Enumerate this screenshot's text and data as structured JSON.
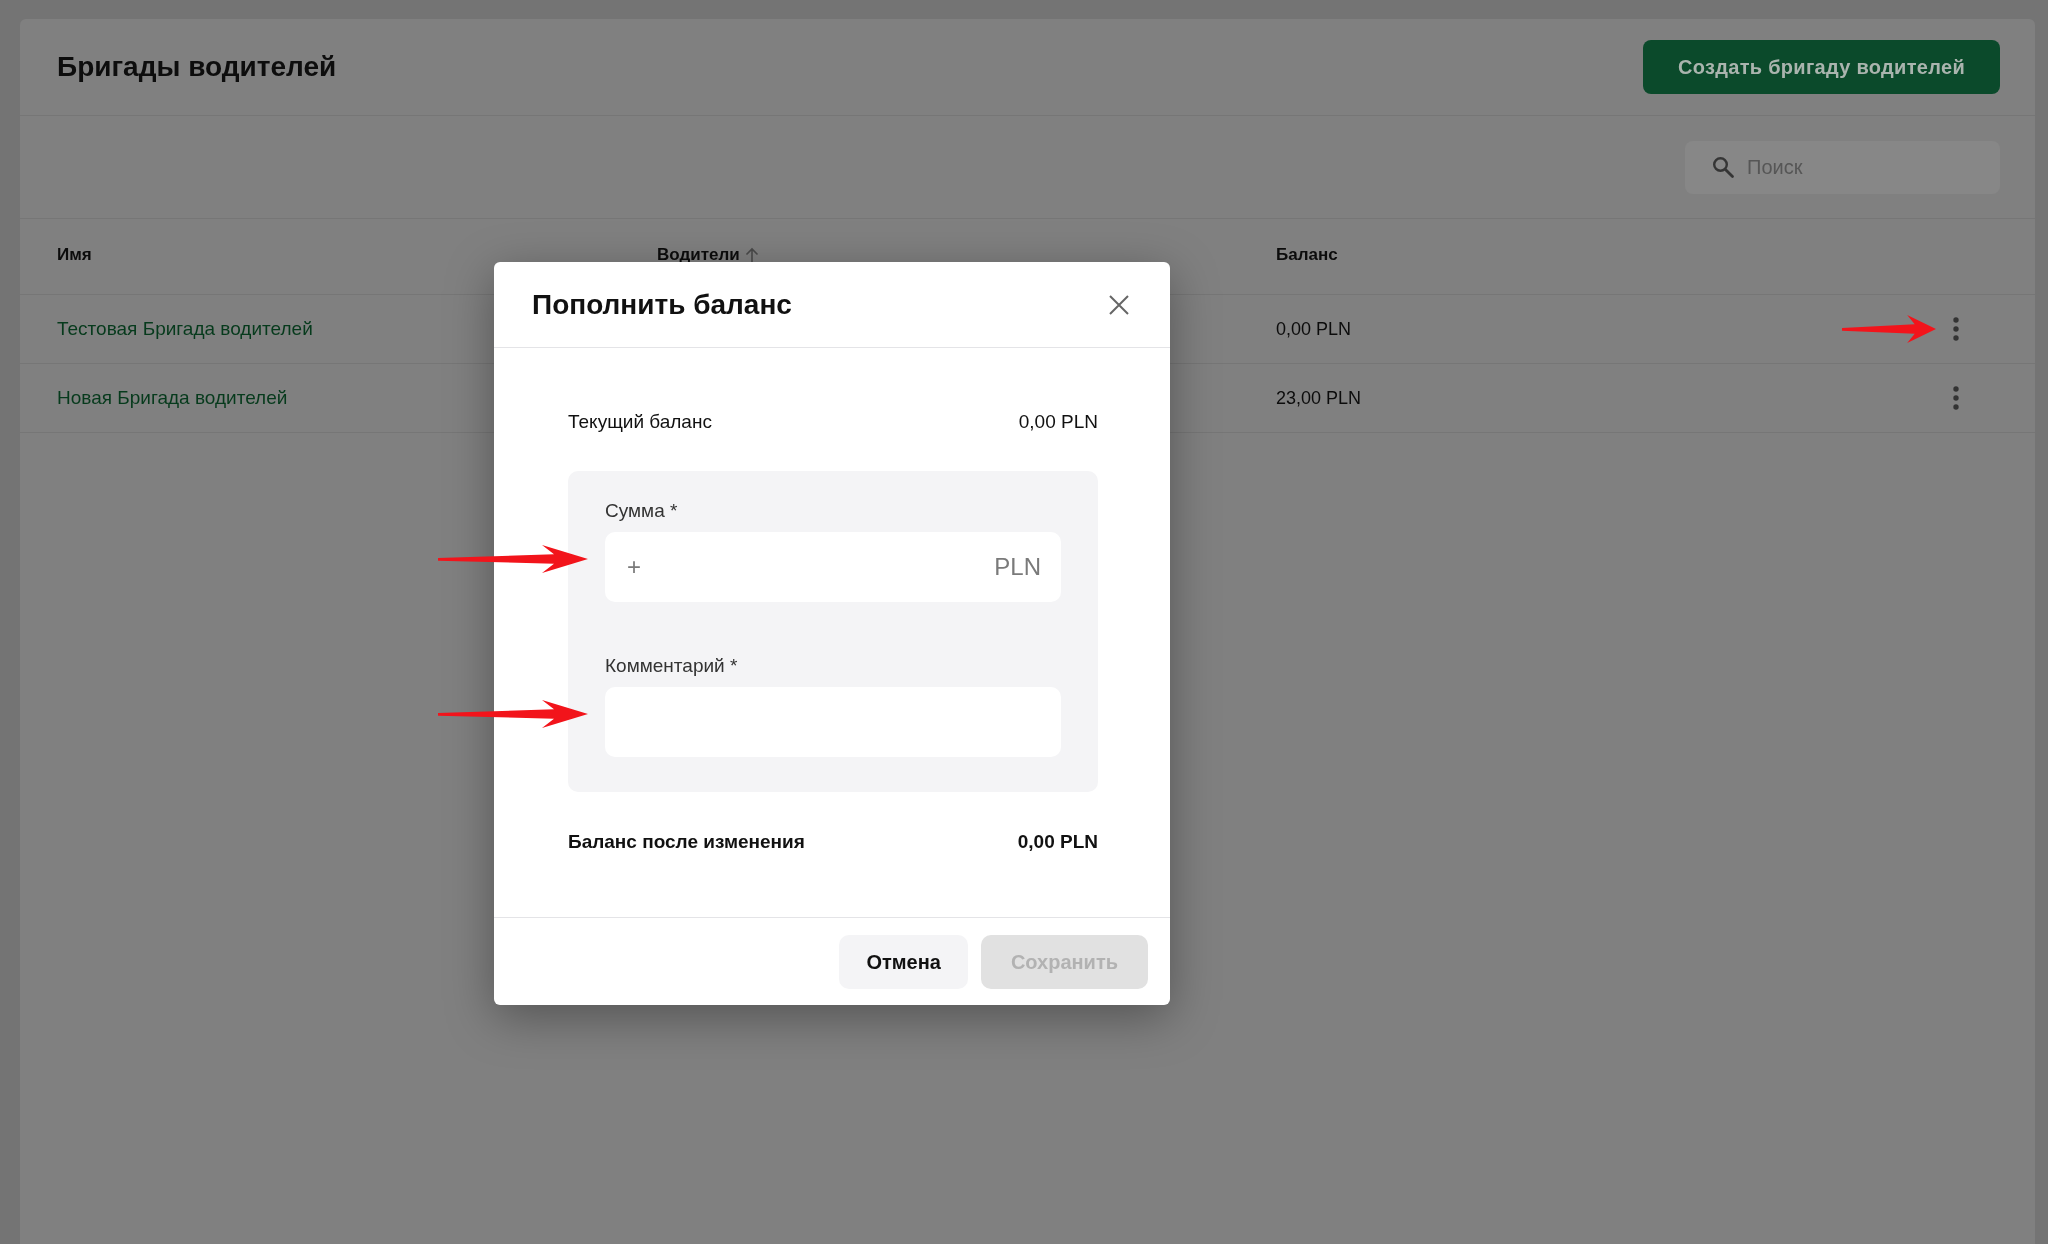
{
  "page": {
    "title": "Бригады водителей",
    "create_button": "Создать бригаду водителей"
  },
  "search": {
    "placeholder": "Поиск"
  },
  "table": {
    "columns": [
      {
        "label": "Имя",
        "sorted": false
      },
      {
        "label": "Водители",
        "sorted": true
      },
      {
        "label": "Баланс",
        "sorted": false
      }
    ],
    "rows": [
      {
        "name": "Тестовая Бригада водителей",
        "balance": "0,00 PLN",
        "arrow": true
      },
      {
        "name": "Новая Бригада водителей",
        "balance": "23,00 PLN",
        "arrow": false
      }
    ]
  },
  "dialog": {
    "title": "Пополнить баланс",
    "current_balance": {
      "label": "Текущий баланс",
      "value": "0,00 PLN"
    },
    "fields": [
      {
        "kind": "currency",
        "label": "Сумма *",
        "prefix": "+",
        "suffix": "PLN",
        "arrow": true
      },
      {
        "kind": "text",
        "label": "Комментарий *",
        "arrow": true
      }
    ],
    "result": {
      "label": "Баланс после изменения",
      "value": "0,00 PLN"
    },
    "buttons": [
      {
        "label": "Отмена",
        "disabled": false
      },
      {
        "label": "Сохранить",
        "disabled": true
      }
    ]
  }
}
